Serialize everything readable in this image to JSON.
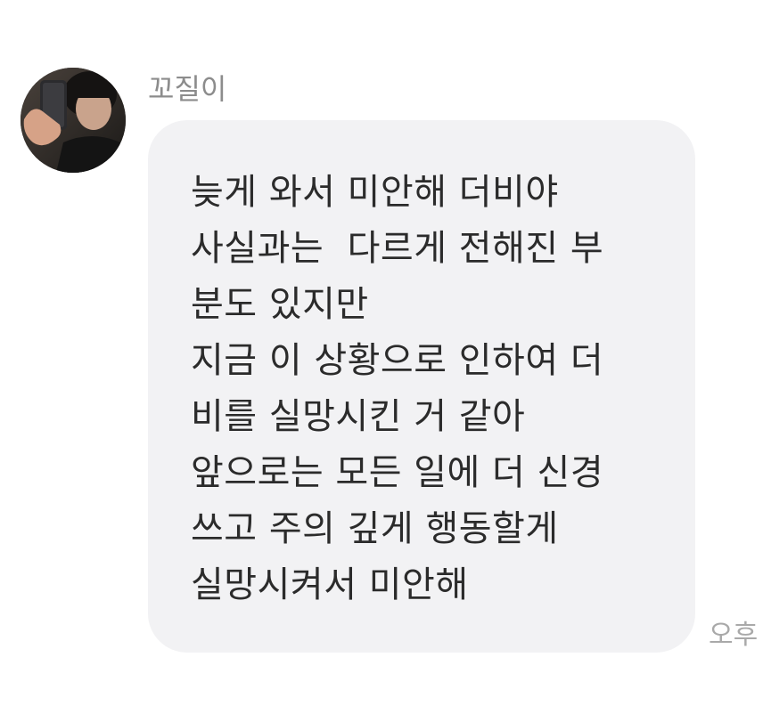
{
  "message": {
    "sender": {
      "name": "꼬질이",
      "avatar_icon": "profile-photo-icon"
    },
    "text_lines": [
      "늦게 와서 미안해 더비야",
      "사실과는  다르게 전해진 부",
      "분도 있지만",
      "지금 이 상황으로 인하여 더",
      "비를 실망시킨 거 같아",
      "앞으로는 모든 일에 더 신경",
      "쓰고 주의 깊게 행동할게",
      "실망시켜서 미안해"
    ],
    "time": "오후",
    "colors": {
      "bubble": "#f2f2f4",
      "text": "#2b2b2b",
      "sender_name": "#8c8c8c",
      "time": "#a9a9a9"
    }
  }
}
